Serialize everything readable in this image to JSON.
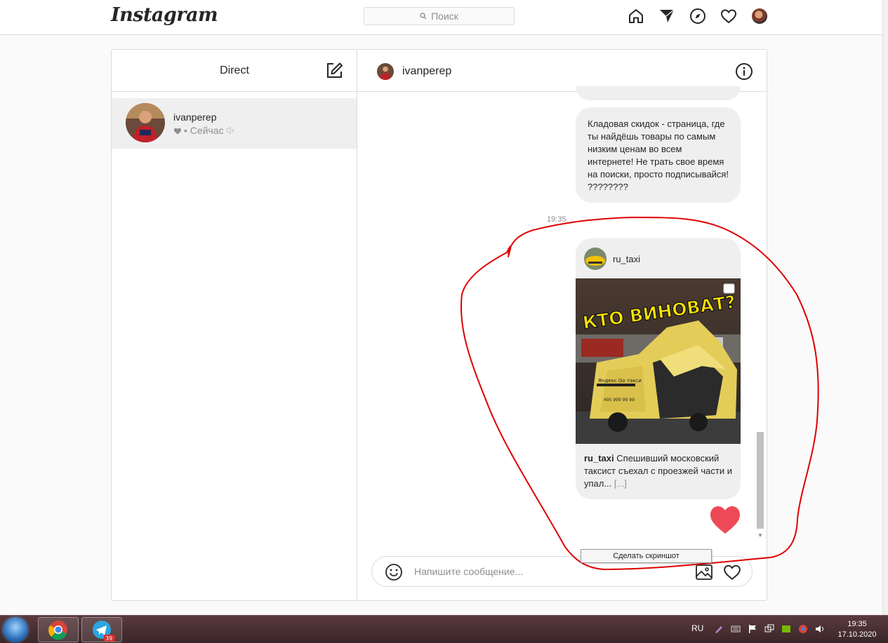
{
  "topbar": {
    "logo": "Instagram",
    "search_placeholder": "Поиск"
  },
  "left_pane": {
    "title": "Direct",
    "threads": [
      {
        "username": "ivanperep",
        "status": "• Сейчас"
      }
    ]
  },
  "chat": {
    "username": "ivanperep",
    "messages": [
      {
        "text": "Кладовая скидок - страница, где ты найдёшь товары по самым низким ценам во всем интернете! Не трать свое время на поиски, просто подписывайся! ????????"
      }
    ],
    "timestamp": "19:35",
    "shared_post": {
      "user": "ru_taxi",
      "image_headline": "КТО ВИНОВАТ?",
      "caption_user": "ru_taxi",
      "caption_text": "Спешивший московский таксист съехал с проезжей части и упал...",
      "more": "[...]"
    }
  },
  "composer": {
    "placeholder": "Напишите сообщение..."
  },
  "tooltip": "Сделать скриншот",
  "taskbar": {
    "lang": "RU",
    "time": "19:35",
    "date": "17.10.2020",
    "telegram_badge": "39"
  },
  "colors": {
    "heart": "#ed4956",
    "annotation": "#e00000",
    "bubble": "#efefef"
  }
}
